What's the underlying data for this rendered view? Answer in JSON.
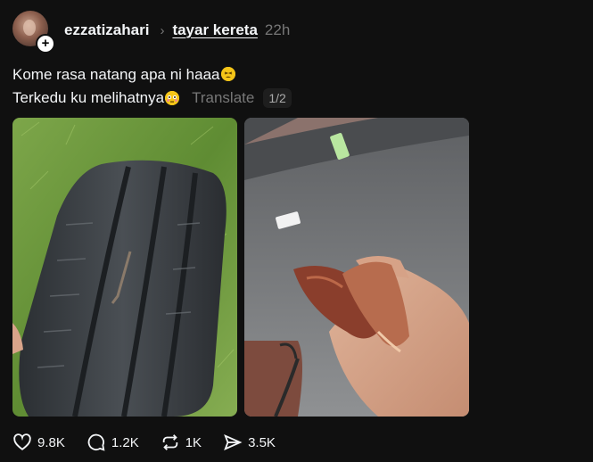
{
  "post": {
    "username": "ezzatizahari",
    "topic": "tayar kereta",
    "time": "22h",
    "text_line1": "Kome rasa natang apa ni haaa",
    "text_line2": "Terkedu ku melihatnya",
    "translate": "Translate",
    "pager": "1/2"
  },
  "actions": {
    "likes": "9.8K",
    "comments": "1.2K",
    "reposts": "1K",
    "shares": "3.5K"
  },
  "icons": {
    "emoji1": "tired-face-emoji",
    "emoji2": "flushed-face-emoji",
    "like": "heart-icon",
    "comment": "speech-bubble-icon",
    "repost": "repost-icon",
    "share": "send-icon"
  }
}
